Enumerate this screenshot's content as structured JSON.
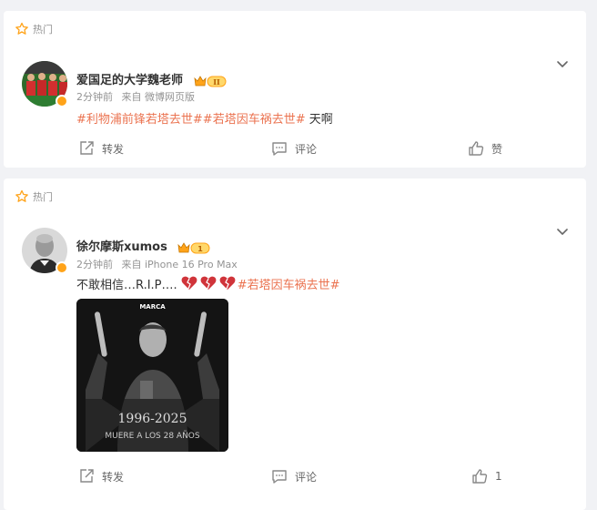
{
  "posts": [
    {
      "hot_label": "热门",
      "author": "爱国足的大学魏老师",
      "vip_level": "II",
      "time": "2分钟前",
      "source": "来自 微博网页版",
      "hashtags": [
        "#利物浦前锋若塔去世#",
        "#若塔因车祸去世#"
      ],
      "text": " 天啊",
      "repost_label": "转发",
      "comment_label": "评论",
      "like_label": "赞"
    },
    {
      "hot_label": "热门",
      "author": "徐尔摩斯xumos",
      "vip_level": "1",
      "time": "2分钟前",
      "source": "来自 iPhone 16 Pro Max",
      "text": "不敢相信…R.I.P….",
      "hashtag": "#若塔因车祸去世#",
      "image": {
        "brand": "MARCA",
        "years": "1996-2025",
        "caption": "MUERE A LOS 28 AÑOS"
      },
      "repost_label": "转发",
      "comment_label": "评论",
      "like_count": "1"
    }
  ],
  "colors": {
    "accent": "#eb7350",
    "vip_gold": "#ffa319",
    "meta": "#939393",
    "background": "#f1f2f5"
  }
}
